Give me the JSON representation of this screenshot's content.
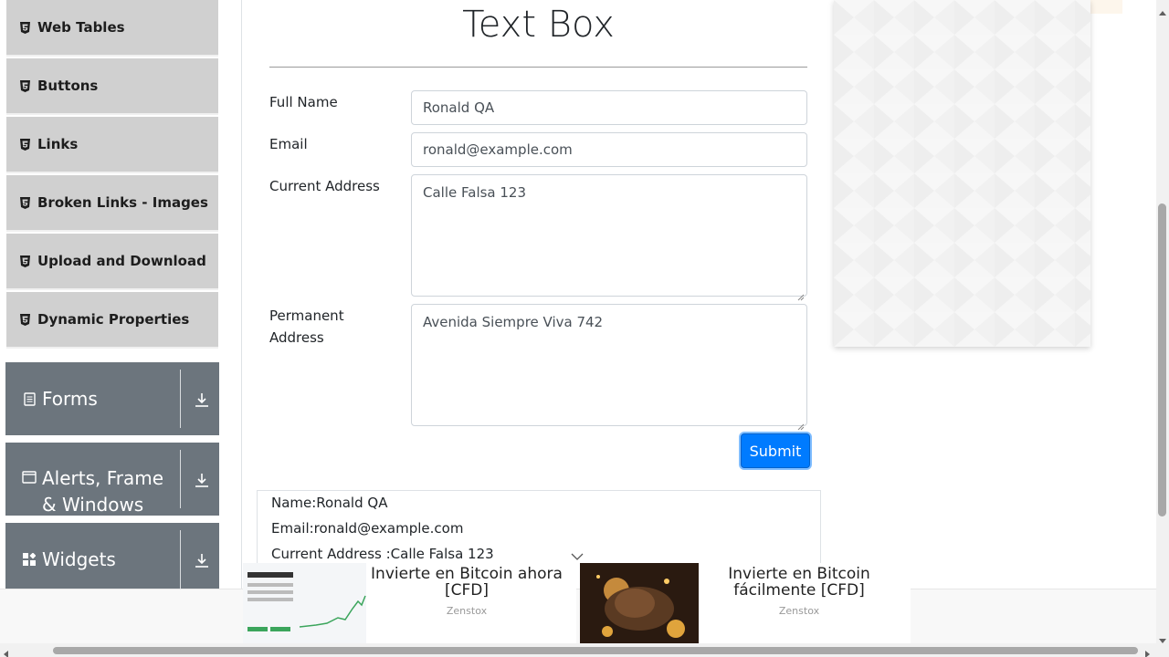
{
  "sidebar": {
    "items": [
      {
        "label": "Web Tables"
      },
      {
        "label": "Buttons"
      },
      {
        "label": "Links"
      },
      {
        "label": "Broken Links - Images"
      },
      {
        "label": "Upload and Download"
      },
      {
        "label": "Dynamic Properties"
      }
    ],
    "groups": [
      {
        "label": "Forms",
        "icon": "document-icon"
      },
      {
        "label": "Alerts, Frame & Windows",
        "icon": "window-icon"
      },
      {
        "label": "Widgets",
        "icon": "widgets-icon"
      }
    ]
  },
  "main": {
    "title": "Text Box",
    "form": {
      "full_name_label": "Full Name",
      "full_name_value": "Ronald QA",
      "email_label": "Email",
      "email_value": "ronald@example.com",
      "current_address_label": "Current Address",
      "current_address_value": "Calle Falsa 123",
      "permanent_address_label_1": "Permanent",
      "permanent_address_label_2": "Address",
      "permanent_address_value": "Avenida Siempre Viva 742",
      "submit_label": "Submit"
    },
    "output": {
      "name": "Name:Ronald QA",
      "email": "Email:ronald@example.com",
      "current_address": "Current Address :Calle Falsa 123"
    }
  },
  "bottom_ad": {
    "ads": [
      {
        "title": "Invierte en Bitcoin ahora [CFD]",
        "source": "Zenstox"
      },
      {
        "title": "Invierte en Bitcoin fácilmente [CFD]",
        "source": "Zenstox"
      }
    ]
  },
  "colors": {
    "primary": "#007bff",
    "sidebar_item_bg": "#d0d0d0",
    "group_bg": "#6c757d"
  }
}
